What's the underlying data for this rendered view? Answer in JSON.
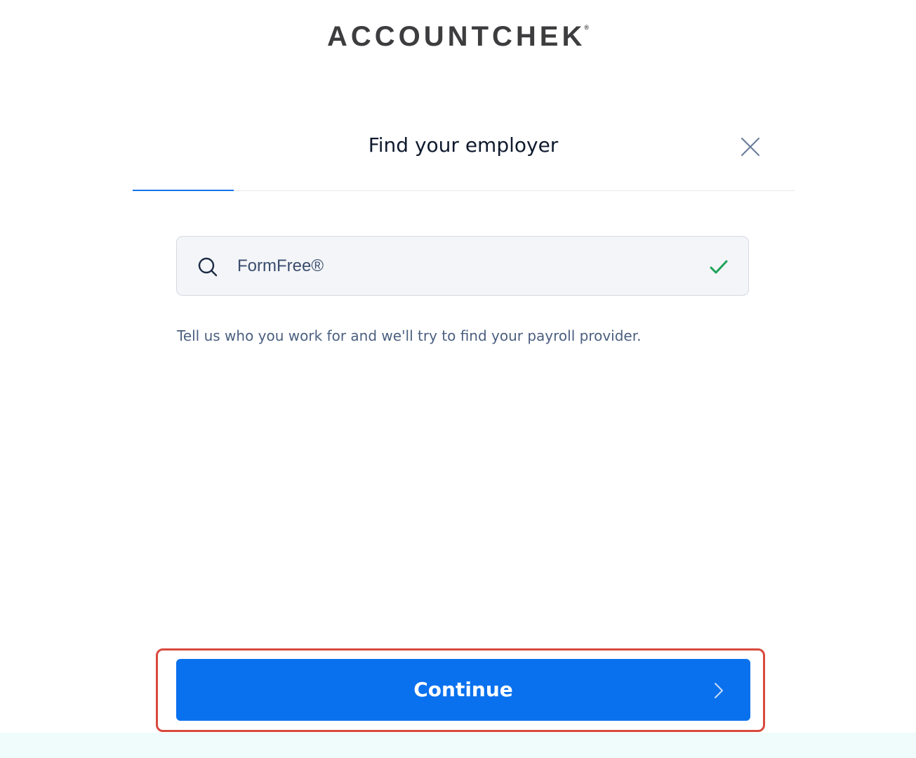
{
  "brand": {
    "name": "ACCOUNTCHEK",
    "registered_mark": "®"
  },
  "header": {
    "title": "Find your employer",
    "close_icon": "close-icon"
  },
  "progress": {
    "fraction": 0.15
  },
  "search": {
    "value": "FormFree®",
    "icon": "search-icon",
    "status_icon": "check-icon"
  },
  "helper_text": "Tell us who you work for and we'll try to find your payroll provider.",
  "continue_button": {
    "label": "Continue",
    "icon": "chevron-right-icon"
  },
  "colors": {
    "accent": "#0a71ee",
    "success": "#1fa35a",
    "highlight": "#d9493e",
    "footer": "#f0fcfc"
  }
}
